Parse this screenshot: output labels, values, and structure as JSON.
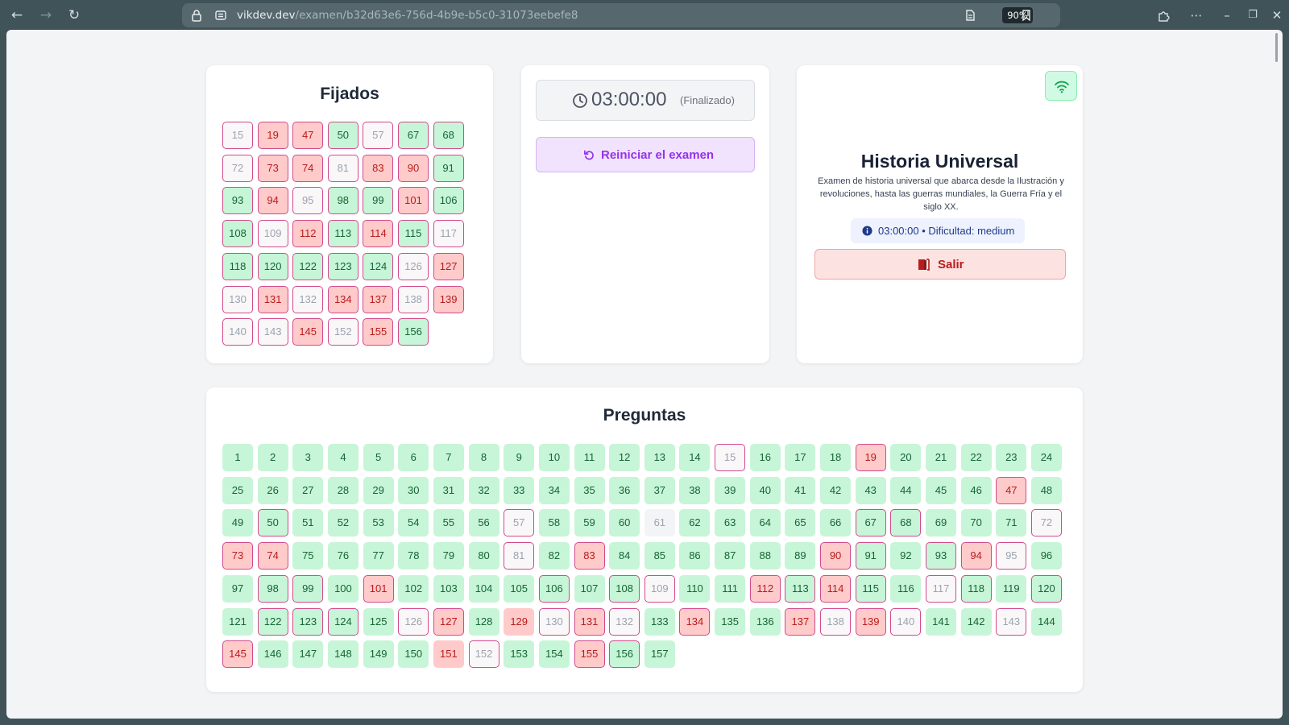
{
  "browser": {
    "url_host": "vikdev.dev",
    "url_path": "/examen/b32d63e6-756d-4b9e-b5c0-31073eebefe8",
    "zoom": "90%"
  },
  "colors": {
    "correct_bg": "#c7f5d7",
    "wrong_bg": "#fecaca",
    "blank_bg": "#f3f4f6",
    "pinned_border": "#d24a8c",
    "restart_accent": "#9333ea",
    "exit_accent": "#b91c1c"
  },
  "fixed": {
    "title": "Fijados",
    "items": [
      {
        "n": "15",
        "s": "b"
      },
      {
        "n": "19",
        "s": "w"
      },
      {
        "n": "47",
        "s": "w"
      },
      {
        "n": "50",
        "s": "c"
      },
      {
        "n": "57",
        "s": "b"
      },
      {
        "n": "67",
        "s": "c"
      },
      {
        "n": "68",
        "s": "c"
      },
      {
        "n": "72",
        "s": "b"
      },
      {
        "n": "73",
        "s": "w"
      },
      {
        "n": "74",
        "s": "w"
      },
      {
        "n": "81",
        "s": "b"
      },
      {
        "n": "83",
        "s": "w"
      },
      {
        "n": "90",
        "s": "w"
      },
      {
        "n": "91",
        "s": "c"
      },
      {
        "n": "93",
        "s": "c"
      },
      {
        "n": "94",
        "s": "w"
      },
      {
        "n": "95",
        "s": "b"
      },
      {
        "n": "98",
        "s": "c"
      },
      {
        "n": "99",
        "s": "c"
      },
      {
        "n": "101",
        "s": "w"
      },
      {
        "n": "106",
        "s": "c"
      },
      {
        "n": "108",
        "s": "c"
      },
      {
        "n": "109",
        "s": "b"
      },
      {
        "n": "112",
        "s": "w"
      },
      {
        "n": "113",
        "s": "c"
      },
      {
        "n": "114",
        "s": "w"
      },
      {
        "n": "115",
        "s": "c"
      },
      {
        "n": "117",
        "s": "b"
      },
      {
        "n": "118",
        "s": "c"
      },
      {
        "n": "120",
        "s": "c"
      },
      {
        "n": "122",
        "s": "c"
      },
      {
        "n": "123",
        "s": "c"
      },
      {
        "n": "124",
        "s": "c"
      },
      {
        "n": "126",
        "s": "b"
      },
      {
        "n": "127",
        "s": "w"
      },
      {
        "n": "130",
        "s": "b"
      },
      {
        "n": "131",
        "s": "w"
      },
      {
        "n": "132",
        "s": "b"
      },
      {
        "n": "134",
        "s": "w"
      },
      {
        "n": "137",
        "s": "w"
      },
      {
        "n": "138",
        "s": "b"
      },
      {
        "n": "139",
        "s": "w"
      },
      {
        "n": "140",
        "s": "b"
      },
      {
        "n": "143",
        "s": "b"
      },
      {
        "n": "145",
        "s": "w"
      },
      {
        "n": "152",
        "s": "b"
      },
      {
        "n": "155",
        "s": "w"
      },
      {
        "n": "156",
        "s": "c"
      }
    ]
  },
  "timer": {
    "time": "03:00:00",
    "status": "(Finalizado)",
    "restart_label": "Reiniciar el examen"
  },
  "exam": {
    "title": "Historia Universal",
    "description": "Examen de historia universal que abarca desde la Ilustración y revoluciones, hasta las guerras mundiales, la Guerra Fría y el siglo XX.",
    "meta": "03:00:00 • Dificultad: medium",
    "exit_label": "Salir"
  },
  "questions": {
    "title": "Preguntas",
    "total": 157,
    "wrong": [
      19,
      47,
      73,
      74,
      83,
      90,
      94,
      101,
      112,
      114,
      127,
      129,
      131,
      134,
      137,
      139,
      145,
      151,
      155
    ],
    "blank": [
      15,
      57,
      61,
      72,
      81,
      95,
      109,
      117,
      126,
      130,
      132,
      138,
      140,
      143,
      152
    ],
    "pinned": [
      15,
      19,
      47,
      50,
      57,
      67,
      68,
      72,
      73,
      74,
      81,
      83,
      90,
      91,
      93,
      94,
      95,
      98,
      99,
      101,
      106,
      108,
      109,
      112,
      113,
      114,
      115,
      117,
      118,
      120,
      122,
      123,
      124,
      126,
      127,
      130,
      131,
      132,
      134,
      137,
      138,
      139,
      140,
      143,
      145,
      152,
      155,
      156
    ]
  }
}
